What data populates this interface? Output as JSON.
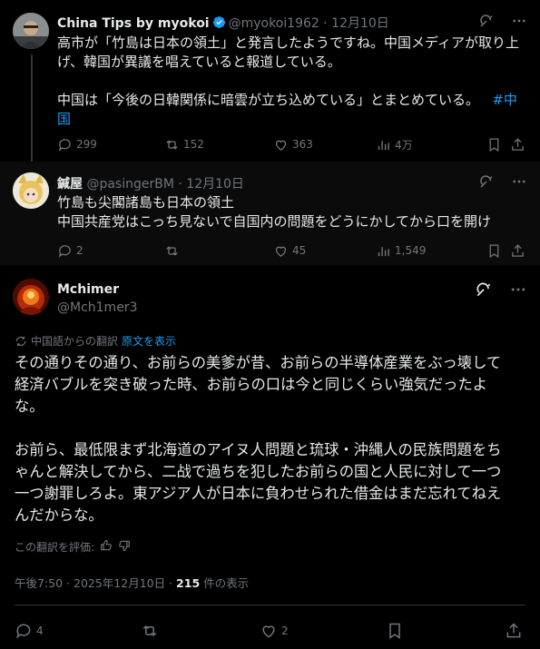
{
  "post1": {
    "name": "China Tips by myokoi",
    "handle": "@myokoi1962",
    "date": "12月10日",
    "text_line1": "高市が「竹島は日本の領土」と発言したようですね。中国メディアが取り上",
    "text_line2": "げ、韓国が異議を唱えていると報道している。",
    "text_line3": "中国は「今後の日韓関係に暗雲が立ち込めている」とまとめている。",
    "hashtag_part1": "#中",
    "hashtag_part2": "国",
    "replies": "299",
    "reposts": "152",
    "likes": "363",
    "views": "4万"
  },
  "post2": {
    "name": "鍼屋",
    "handle": "@pasingerBM",
    "date": "12月10日",
    "text_line1": "竹島も尖閣諸島も日本の領土",
    "text_line2": "中国共産党はこっち見ないで自国内の問題をどうにかしてから口を開け",
    "replies": "2",
    "reposts": "",
    "likes": "45",
    "views": "1,549"
  },
  "main": {
    "name": "Mchimer",
    "handle": "@Mch1mer3",
    "translated_from": "中国語からの翻訳",
    "show_original": "原文を表示",
    "para1_line1": "その通りその通り、お前らの美爹が昔、お前らの半導体産業をぶっ壊して",
    "para1_line2": "経済バブルを突き破った時、お前らの口は今と同じくらい強気だったよ",
    "para1_line3": "な。",
    "para2_line1": "お前ら、最低限まず北海道のアイヌ人問題と琉球・沖縄人の民族問題をち",
    "para2_line2": "ゃんと解決してから、二战で過ちを犯したお前らの国と人民に対して一つ",
    "para2_line3": "一つ謝罪しろよ。東アジア人が日本に負わせられた借金はまだ忘れてねえ",
    "para2_line4": "んだからな。",
    "rate_translation": "この翻訳を評価:",
    "timestamp": "午後7:50 · 2025年12月10日 · ",
    "views_count": "215",
    "views_label": " 件の表示",
    "replies": "4",
    "reposts": "",
    "likes": "2"
  },
  "colors": {
    "accent": "#1d9bf0",
    "muted": "#71767b",
    "text": "#e7e9ea",
    "bg": "#000000"
  }
}
